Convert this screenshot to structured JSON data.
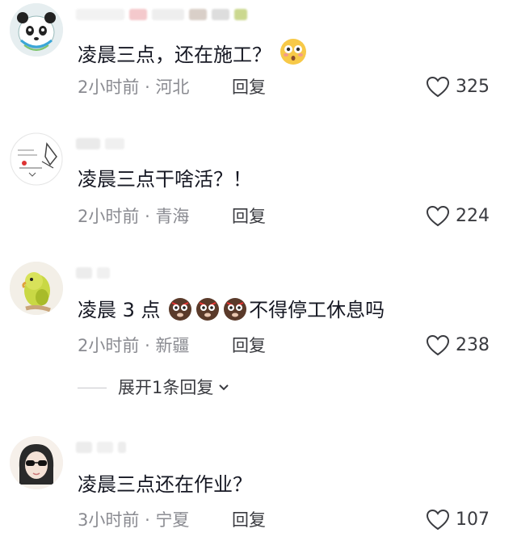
{
  "comments": [
    {
      "username": "",
      "text": "凌晨三点，还在施工？",
      "time": "2小时前",
      "location": "河北",
      "reply_label": "回复",
      "likes": "325",
      "avatar": "panda-mascot-avatar",
      "trailing_emoji": "flushed-face-emoji"
    },
    {
      "username": "",
      "text": "凌晨三点干啥活？！",
      "time": "2小时前",
      "location": "青海",
      "reply_label": "回复",
      "likes": "224",
      "avatar": "sketch-drawing-avatar"
    },
    {
      "username": "",
      "text_before": "凌晨 3 点",
      "text_after": "不得停工休息吗",
      "time": "2小时前",
      "location": "新疆",
      "reply_label": "回复",
      "likes": "238",
      "avatar": "parrot-avatar",
      "inline_emoji": "angry-face-emoji",
      "inline_emoji_count": 3
    },
    {
      "username": "",
      "text": "凌晨三点还在作业？",
      "time": "3小时前",
      "location": "宁夏",
      "reply_label": "回复",
      "likes": "107",
      "avatar": "girl-sunglasses-avatar"
    }
  ],
  "expand_replies": {
    "label": "展开1条回复"
  },
  "separator": "·",
  "colors": {
    "text": "#161823",
    "meta": "#8a8b91",
    "heart_stroke": "#3a3b40"
  }
}
